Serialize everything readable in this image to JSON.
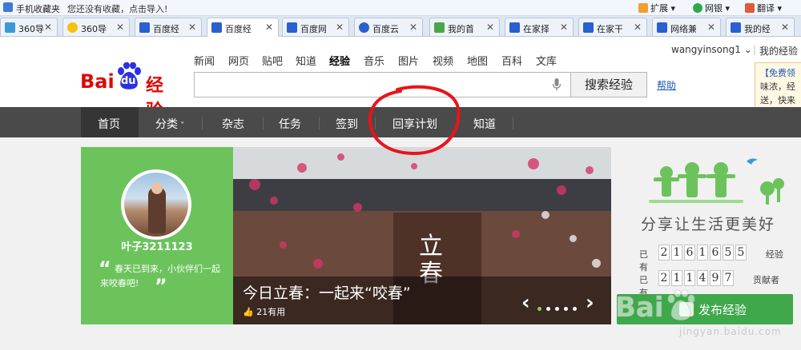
{
  "favorites_bar": {
    "title": "手机收藏夹",
    "hint": "您还没有收藏，点击导入!",
    "tools": [
      {
        "label": "扩展",
        "icon": "grid-icon",
        "color": "#f0a030"
      },
      {
        "label": "网银",
        "icon": "shield-icon",
        "color": "#2fa84f"
      },
      {
        "label": "翻译",
        "icon": "translate-icon",
        "color": "#e05a3a"
      }
    ]
  },
  "tabs": [
    {
      "label": "360导",
      "icon": "360-icon",
      "color": "#3a9ad9"
    },
    {
      "label": "360导",
      "icon": "360-icon",
      "color": "#f4c20d"
    },
    {
      "label": "百度经",
      "icon": "baidu-paw-icon",
      "color": "#2a5fd0"
    },
    {
      "label": "百度经",
      "icon": "baidu-paw-icon",
      "color": "#2a5fd0",
      "active": true
    },
    {
      "label": "百度网",
      "icon": "baidu-paw-icon",
      "color": "#2a5fd0"
    },
    {
      "label": "百度云",
      "icon": "cloud-icon",
      "color": "#2a5fd0"
    },
    {
      "label": "我的首",
      "icon": "home-icon",
      "color": "#4aa64a"
    },
    {
      "label": "在家择",
      "icon": "baidu-paw-icon",
      "color": "#2a5fd0"
    },
    {
      "label": "在家干",
      "icon": "baidu-paw-icon",
      "color": "#2a5fd0"
    },
    {
      "label": "网络兼",
      "icon": "baidu-paw-icon",
      "color": "#2a5fd0"
    },
    {
      "label": "我的经",
      "icon": "baidu-paw-icon",
      "color": "#2a5fd0"
    }
  ],
  "header": {
    "logo": {
      "bai": "Bai",
      "du": "du",
      "jingyan": "经验"
    },
    "nav": [
      "新闻",
      "网页",
      "贴吧",
      "知道",
      "经验",
      "音乐",
      "图片",
      "视频",
      "地图",
      "百科",
      "文库"
    ],
    "nav_current": "经验",
    "search_button": "搜索经验",
    "help": "帮助",
    "username": "wangyinsong1",
    "my_jingyan": "我的经验",
    "popup_lines": [
      "【免费领",
      "味浓，经",
      "送，快来"
    ]
  },
  "category_bar": {
    "items": [
      "首页",
      "分类",
      "杂志",
      "任务",
      "签到",
      "回享计划",
      "知道"
    ]
  },
  "profile": {
    "name": "叶子3211123",
    "quote": "春天已到来，小伙伴们一起来咬春吧!"
  },
  "banner": {
    "vertical_title": "立春",
    "caption": "今日立春：一起来“咬春”",
    "likes": "21有用"
  },
  "sidebar": {
    "slogan": "分享让生活更美好",
    "stats": [
      {
        "prefix": "已有",
        "digits": [
          "2",
          "1",
          "6",
          "1",
          "6",
          "5",
          "5"
        ],
        "suffix": "经验"
      },
      {
        "prefix": "已有",
        "digits": [
          "2",
          "1",
          "1",
          "4",
          "9",
          "7"
        ],
        "suffix": "贡献者"
      }
    ],
    "publish_button": "发布经验",
    "watermark_site": "jingyan.baidu.com"
  },
  "colors": {
    "baidu_red": "#e10602",
    "profile_green": "#6cc35c",
    "publish_green": "#3ea84a",
    "nav_dark": "#4a4a4a",
    "annotation_red": "#e8141a"
  }
}
